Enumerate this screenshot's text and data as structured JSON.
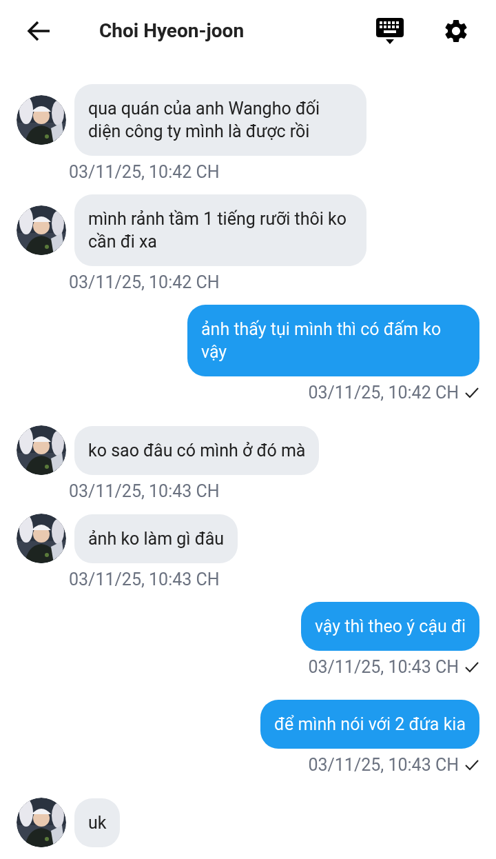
{
  "header": {
    "title": "Choi Hyeon-joon"
  },
  "messages": [
    {
      "kind": "incoming",
      "text": "qua quán của anh Wangho đối diện công ty mình là được rồi",
      "time": "03/11/25, 10:42 CH"
    },
    {
      "kind": "incoming",
      "text": "mình rảnh tầm 1 tiếng rưỡi thôi ko cần đi xa",
      "time": "03/11/25, 10:42 CH"
    },
    {
      "kind": "outgoing",
      "text": "ảnh thấy tụi mình thì có đấm ko vậy",
      "time": "03/11/25, 10:42 CH",
      "read": true
    },
    {
      "kind": "incoming",
      "text": "ko sao đâu có mình ở đó mà",
      "time": "03/11/25, 10:43 CH"
    },
    {
      "kind": "incoming",
      "text": "ảnh ko làm gì đâu",
      "time": "03/11/25, 10:43 CH"
    },
    {
      "kind": "outgoing",
      "text": "vậy thì theo ý cậu đi",
      "time": "03/11/25, 10:43 CH",
      "read": true
    },
    {
      "kind": "outgoing",
      "text": "để mình nói với 2 đứa kia",
      "time": "03/11/25, 10:43 CH",
      "read": true
    },
    {
      "kind": "incoming",
      "text": "uk"
    }
  ]
}
